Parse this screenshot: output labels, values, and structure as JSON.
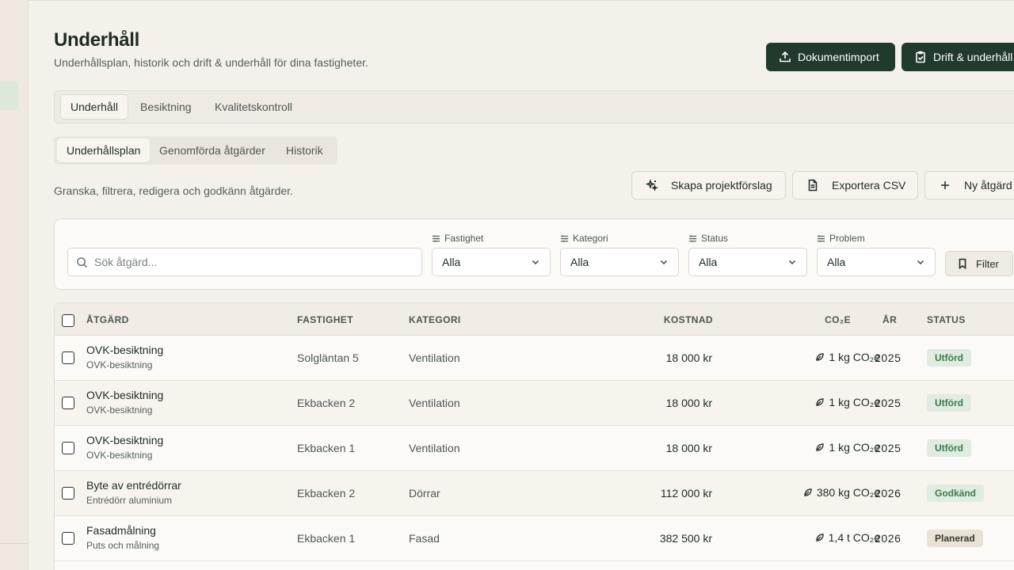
{
  "header": {
    "title": "Underhåll",
    "subtitle": "Underhållsplan, historik och drift & underhåll för dina fastigheter.",
    "import_label": "Dokumentimport",
    "drift_label": "Drift & underhåll"
  },
  "tabs_main": [
    "Underhåll",
    "Besiktning",
    "Kvalitetskontroll"
  ],
  "tabs_sub": [
    "Underhållsplan",
    "Genomförda åtgärder",
    "Historik"
  ],
  "section": {
    "description": "Granska, filtrera, redigera och godkänn åtgärder.",
    "project_label": "Skapa projektförslag",
    "csv_label": "Exportera CSV",
    "new_label": "Ny åtgärd"
  },
  "filters": {
    "search_placeholder": "Sök åtgärd...",
    "fastighet_label": "Fastighet",
    "fastighet_value": "Alla",
    "kategori_label": "Kategori",
    "kategori_value": "Alla",
    "status_label": "Status",
    "status_value": "Alla",
    "problem_label": "Problem",
    "problem_value": "Alla",
    "filter_button": "Filter"
  },
  "table": {
    "columns": {
      "atgard": "ÅTGÄRD",
      "fastighet": "FASTIGHET",
      "kategori": "KATEGORI",
      "kostnad": "KOSTNAD",
      "co2": "CO₂E",
      "ar": "ÅR",
      "status": "STATUS"
    },
    "rows": [
      {
        "title": "OVK-besiktning",
        "sub": "OVK-besiktning",
        "fastighet": "Solgläntan 5",
        "kategori": "Ventilation",
        "kostnad": "18 000 kr",
        "co2": "1 kg CO₂e",
        "ar": "2025",
        "status": "Utförd"
      },
      {
        "title": "OVK-besiktning",
        "sub": "OVK-besiktning",
        "fastighet": "Ekbacken 2",
        "kategori": "Ventilation",
        "kostnad": "18 000 kr",
        "co2": "1 kg CO₂e",
        "ar": "2025",
        "status": "Utförd"
      },
      {
        "title": "OVK-besiktning",
        "sub": "OVK-besiktning",
        "fastighet": "Ekbacken 1",
        "kategori": "Ventilation",
        "kostnad": "18 000 kr",
        "co2": "1 kg CO₂e",
        "ar": "2025",
        "status": "Utförd"
      },
      {
        "title": "Byte av entrédörrar",
        "sub": "Entrédörr aluminium",
        "fastighet": "Ekbacken 2",
        "kategori": "Dörrar",
        "kostnad": "112 000 kr",
        "co2": "380 kg CO₂e",
        "ar": "2026",
        "status": "Godkänd"
      },
      {
        "title": "Fasadmålning",
        "sub": "Puts och målning",
        "fastighet": "Ekbacken 1",
        "kategori": "Fasad",
        "kostnad": "382 500 kr",
        "co2": "1,4 t CO₂e",
        "ar": "2026",
        "status": "Planerad"
      }
    ]
  }
}
